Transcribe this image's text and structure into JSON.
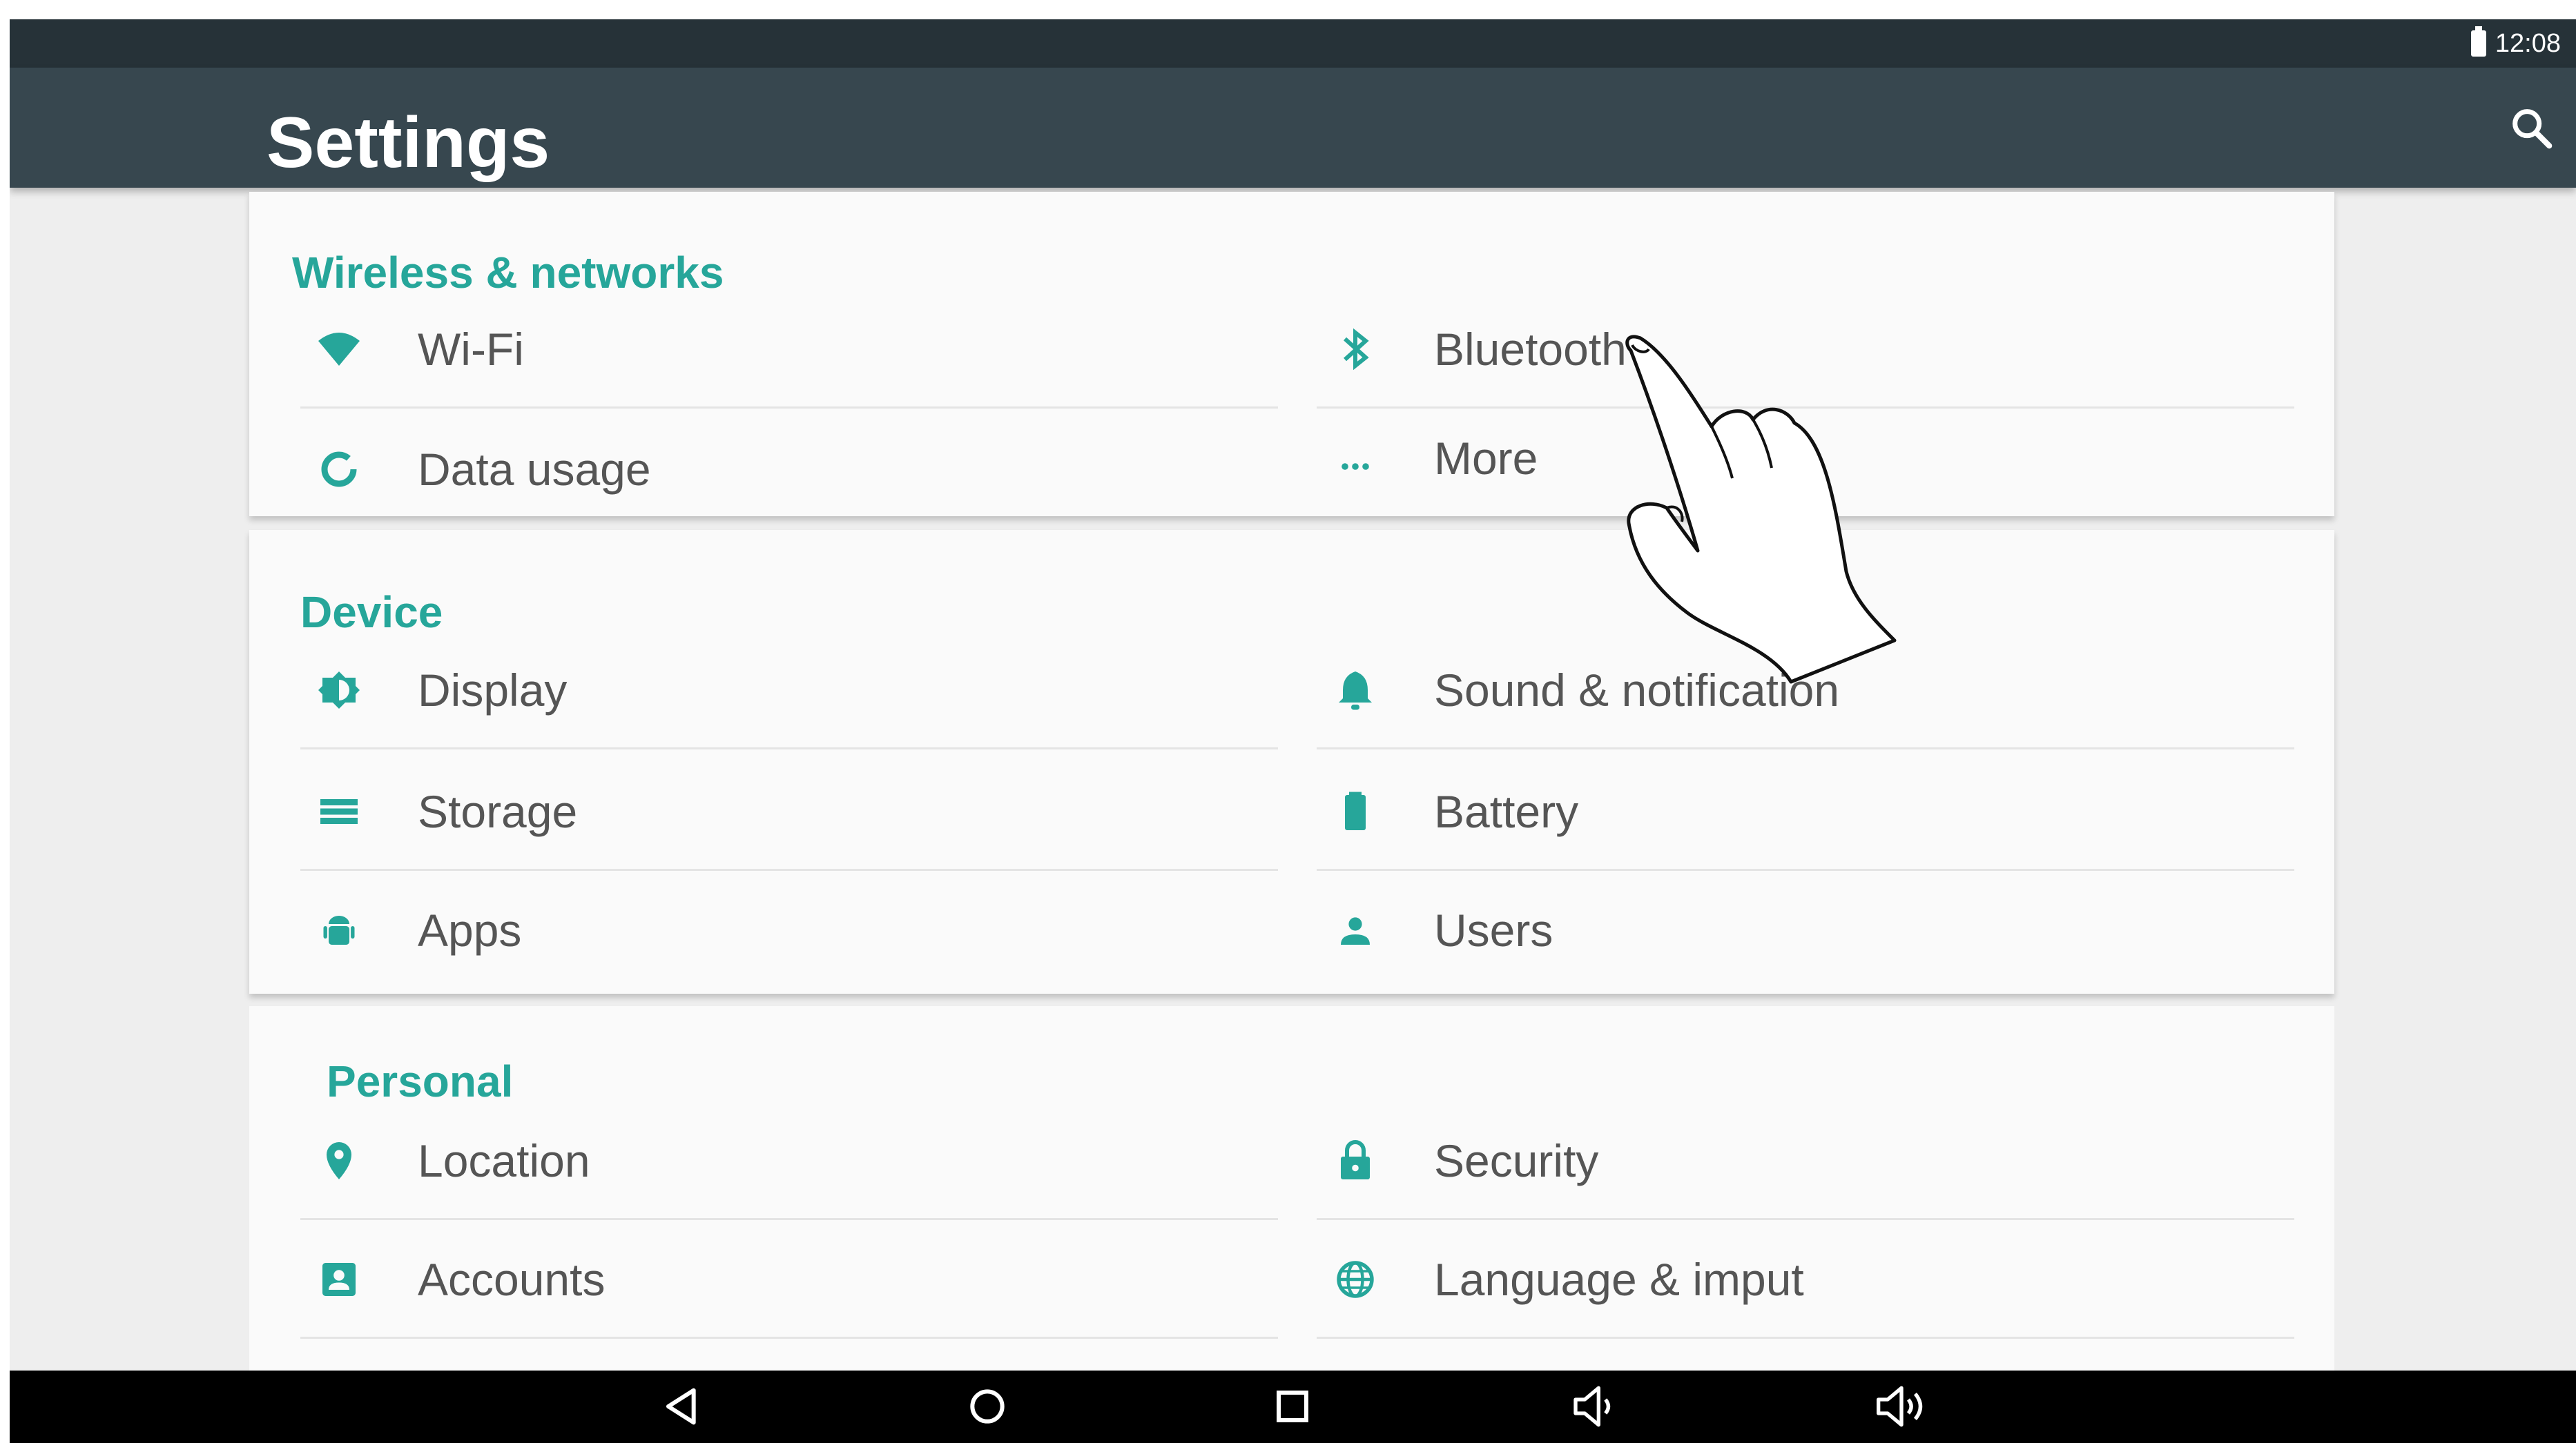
{
  "status_bar": {
    "time": "12:08",
    "battery_icon": "battery-full-icon"
  },
  "action_bar": {
    "title": "Settings",
    "search_icon": "search-icon"
  },
  "accent_color": "#26a69a",
  "sections": [
    {
      "title": "Wireless & networks",
      "items": [
        {
          "label": "Wi-Fi",
          "icon": "wifi-icon"
        },
        {
          "label": "Bluetooth",
          "icon": "bluetooth-icon"
        },
        {
          "label": "Data usage",
          "icon": "data-usage-icon"
        },
        {
          "label": "More",
          "icon": "more-icon"
        }
      ]
    },
    {
      "title": "Device",
      "items": [
        {
          "label": "Display",
          "icon": "display-brightness-icon"
        },
        {
          "label": "Sound & notification",
          "icon": "bell-icon"
        },
        {
          "label": "Storage",
          "icon": "storage-icon"
        },
        {
          "label": "Battery",
          "icon": "battery-icon"
        },
        {
          "label": "Apps",
          "icon": "android-icon"
        },
        {
          "label": "Users",
          "icon": "person-icon"
        }
      ]
    },
    {
      "title": "Personal",
      "items": [
        {
          "label": "Location",
          "icon": "location-pin-icon"
        },
        {
          "label": "Security",
          "icon": "lock-icon"
        },
        {
          "label": "Accounts",
          "icon": "account-box-icon"
        },
        {
          "label": "Language & imput",
          "icon": "globe-icon"
        }
      ]
    }
  ],
  "nav_bar": {
    "buttons": [
      "back-icon",
      "home-icon",
      "recents-icon",
      "volume-down-icon",
      "volume-up-icon"
    ]
  },
  "overlay": {
    "pointer": "tapping-hand-icon"
  }
}
